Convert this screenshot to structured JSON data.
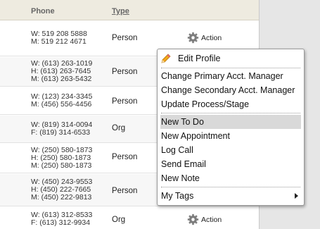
{
  "header": {
    "phone_label": "Phone",
    "type_label": "Type"
  },
  "rows": [
    {
      "phones": [
        "W: 519 208 5888",
        "M: 519 212 4671"
      ],
      "type": "Person",
      "action": "Action"
    },
    {
      "phones": [
        "W: (613) 263-1019",
        "H: (613) 263-7645",
        "M: (613) 263-5432"
      ],
      "type": "Person"
    },
    {
      "phones": [
        "W: (123) 234-3345",
        "M: (456) 556-4456"
      ],
      "type": "Person"
    },
    {
      "phones": [
        "W: (819) 314-0094",
        "F: (819) 314-6533"
      ],
      "type": "Org"
    },
    {
      "phones": [
        "W: (250) 580-1873",
        "H: (250) 580-1873",
        "M: (250) 580-1873"
      ],
      "type": "Person"
    },
    {
      "phones": [
        "W: (450) 243-9553",
        "H: (450) 222-7665",
        "M: (450) 222-9813"
      ],
      "type": "Person"
    },
    {
      "phones": [
        "W: (613) 312-8533",
        "F: (613) 312-9934"
      ],
      "type": "Org",
      "action": "Action"
    }
  ],
  "menu": {
    "edit_profile": "Edit Profile",
    "change_primary": "Change Primary Acct. Manager",
    "change_secondary": "Change Secondary Acct. Manager",
    "update_process": "Update Process/Stage",
    "new_todo": "New To Do",
    "new_appointment": "New Appointment",
    "log_call": "Log Call",
    "send_email": "Send Email",
    "new_note": "New Note",
    "my_tags": "My Tags"
  },
  "icons": {
    "gear": "gear-icon",
    "pencil": "pencil-icon",
    "submenu": "chevron-right-icon"
  },
  "colors": {
    "header_bg": "#eeebe0",
    "menu_highlight": "#d9d9d9",
    "pencil": "#f2a71b"
  }
}
